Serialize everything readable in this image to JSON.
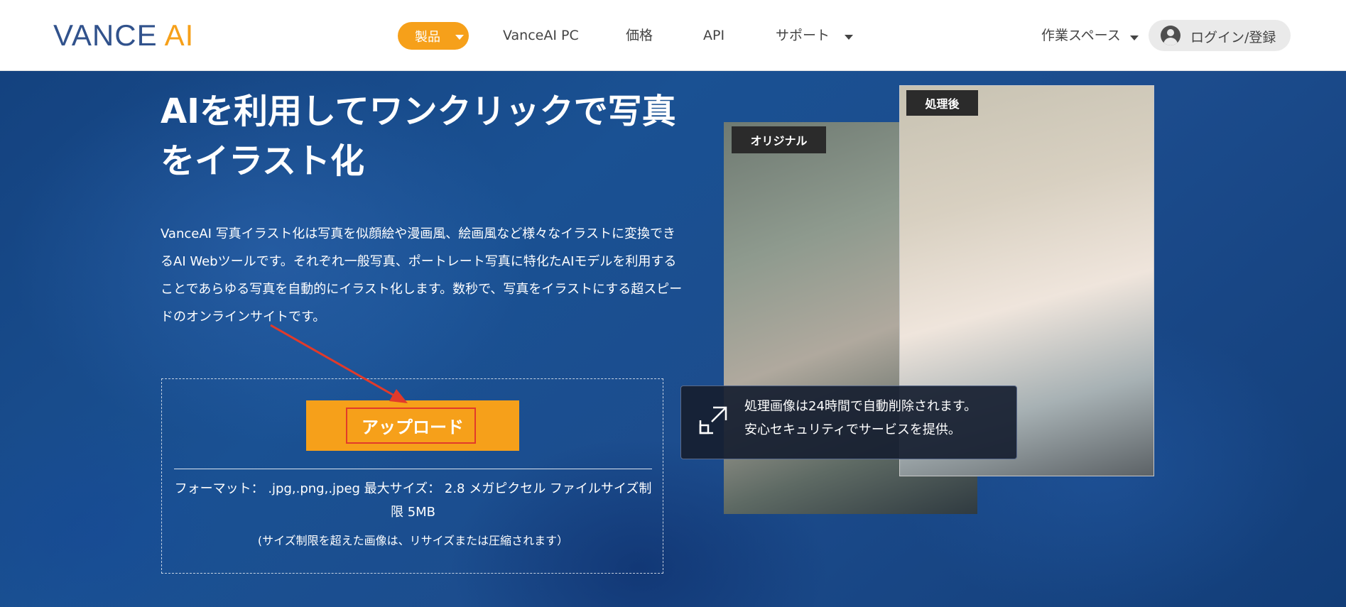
{
  "header": {
    "logo_text_main": "VANCE",
    "logo_text_accent": "AI",
    "nav": {
      "products": "製品",
      "vanceai_pc": "VanceAI PC",
      "pricing": "価格",
      "api": "API",
      "support": "サポート"
    },
    "workspace": "作業スペース",
    "login": "ログイン/登録"
  },
  "hero": {
    "title": "AIを利用してワンクリックで写真をイラスト化",
    "description": "VanceAI 写真イラスト化は写真を似顔絵や漫画風、絵画風など様々なイラストに変換できるAI Webツールです。それぞれ一般写真、ポートレート写真に特化たAIモデルを利用することであらゆる写真を自動的にイラスト化します。数秒で、写真をイラストにする超スピードのオンラインサイトです。",
    "upload_button": "アップロード",
    "format_info": "フォーマット： .jpg,.png,.jpeg 最大サイズ： 2.8 メガピクセル ファイルサイズ制限 5MB",
    "resize_note": "(サイズ制限を超えた画像は、リサイズまたは圧縮されます）",
    "tag_original": "オリジナル",
    "tag_processed": "処理後",
    "notice_line1": "処理画像は24時間で自動削除されます。",
    "notice_line2": "安心セキュリティでサービスを提供。"
  },
  "colors": {
    "brand_blue": "#31528c",
    "brand_orange": "#f6a01a",
    "annotation_red": "#e23a2a"
  },
  "icons": [
    "chevron-down-icon",
    "user-avatar-icon",
    "expand-arrow-icon"
  ]
}
